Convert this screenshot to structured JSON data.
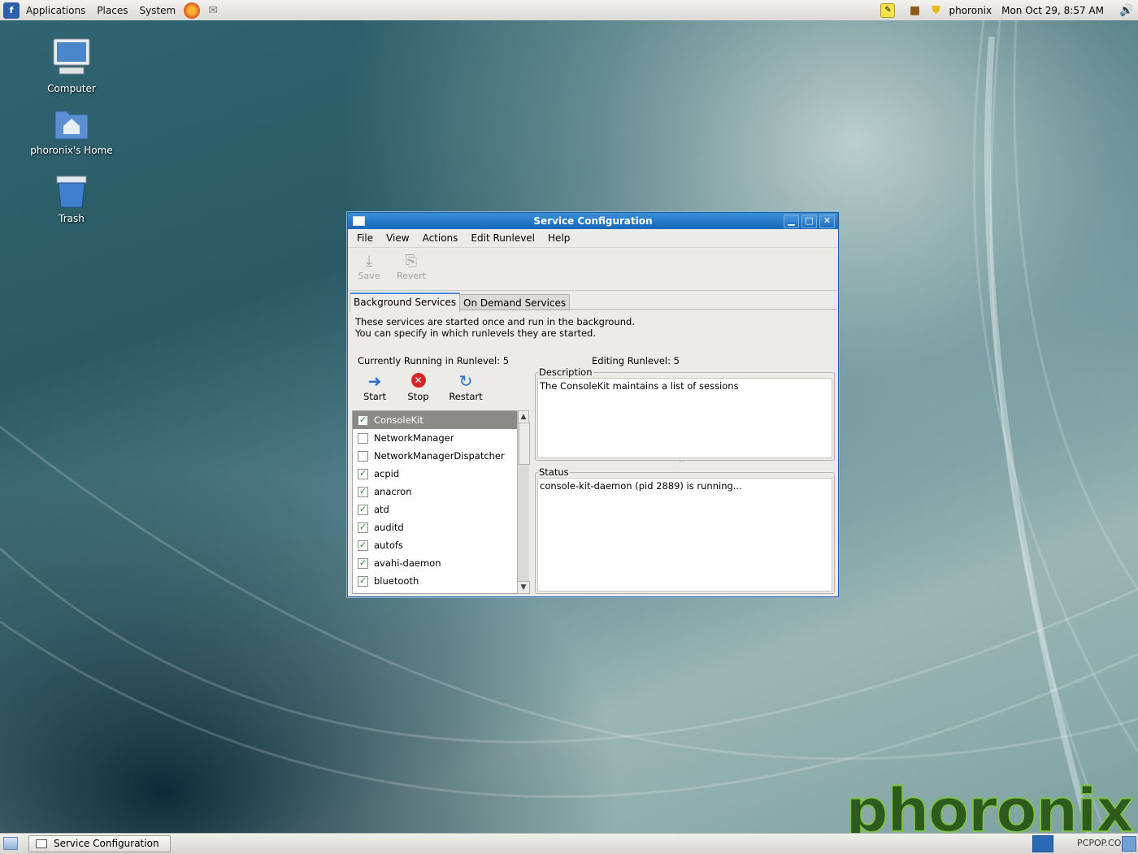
{
  "top_panel": {
    "menus": [
      "Applications",
      "Places",
      "System"
    ],
    "user": "phoronix",
    "clock": "Mon Oct 29,  8:57 AM"
  },
  "desktop": {
    "icons": [
      {
        "label": "Computer",
        "icon": "computer-icon"
      },
      {
        "label": "phoronix's Home",
        "icon": "home-folder-icon"
      },
      {
        "label": "Trash",
        "icon": "trash-icon"
      }
    ],
    "watermark": "phoronix",
    "corner_text": "PCPOP.COM"
  },
  "window": {
    "title": "Service Configuration",
    "menus": [
      "File",
      "View",
      "Actions",
      "Edit Runlevel",
      "Help"
    ],
    "toolbar": {
      "save": "Save",
      "revert": "Revert"
    },
    "tabs": [
      "Background Services",
      "On Demand Services"
    ],
    "info_text": "These services are started once and run in the background. You can specify in which runlevels they are started.",
    "running_runlevel": "Currently Running in Runlevel: 5",
    "editing_runlevel": "Editing Runlevel: 5",
    "actions": {
      "start": "Start",
      "stop": "Stop",
      "restart": "Restart"
    },
    "services": [
      {
        "name": "ConsoleKit",
        "checked": true,
        "selected": true
      },
      {
        "name": "NetworkManager",
        "checked": false
      },
      {
        "name": "NetworkManagerDispatcher",
        "checked": false
      },
      {
        "name": "acpid",
        "checked": true
      },
      {
        "name": "anacron",
        "checked": true
      },
      {
        "name": "atd",
        "checked": true
      },
      {
        "name": "auditd",
        "checked": true
      },
      {
        "name": "autofs",
        "checked": true
      },
      {
        "name": "avahi-daemon",
        "checked": true
      },
      {
        "name": "bluetooth",
        "checked": true
      }
    ],
    "description_label": "Description",
    "description_text": "The ConsoleKit maintains a list of sessions",
    "status_label": "Status",
    "status_text": "console-kit-daemon (pid 2889) is running..."
  },
  "taskbar": {
    "task": "Service Configuration"
  }
}
